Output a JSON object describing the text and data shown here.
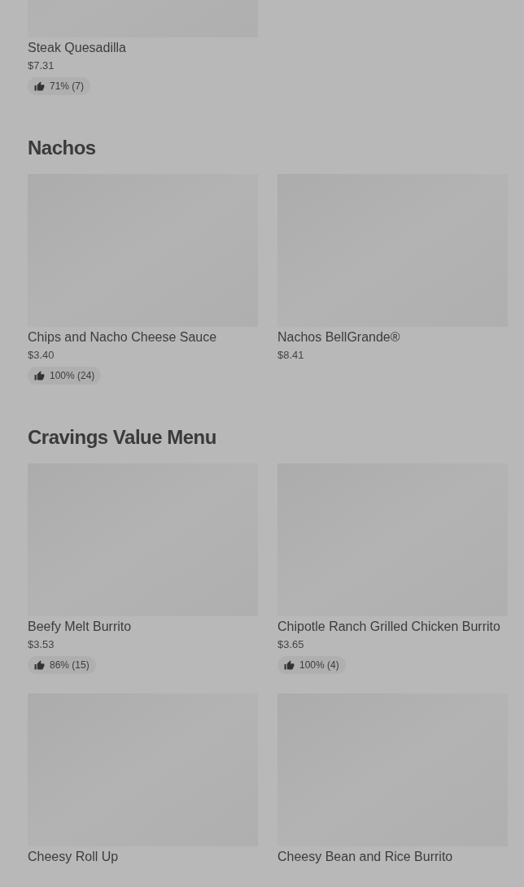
{
  "sections": [
    {
      "items": [
        {
          "name": "Steak Quesadilla",
          "price": "$7.31",
          "rating": "71% (7)"
        }
      ]
    },
    {
      "title": "Nachos",
      "items": [
        {
          "name": "Chips and Nacho Cheese Sauce",
          "price": "$3.40",
          "rating": "100% (24)"
        },
        {
          "name": "Nachos BellGrande®",
          "price": "$8.41"
        }
      ]
    },
    {
      "title": "Cravings Value Menu",
      "items": [
        {
          "name": "Beefy Melt Burrito",
          "price": "$3.53",
          "rating": "86% (15)"
        },
        {
          "name": "Chipotle Ranch Grilled Chicken Burrito",
          "price": "$3.65",
          "rating": "100% (4)"
        },
        {
          "name": "Cheesy Roll Up"
        },
        {
          "name": "Cheesy Bean and Rice Burrito"
        }
      ]
    }
  ]
}
